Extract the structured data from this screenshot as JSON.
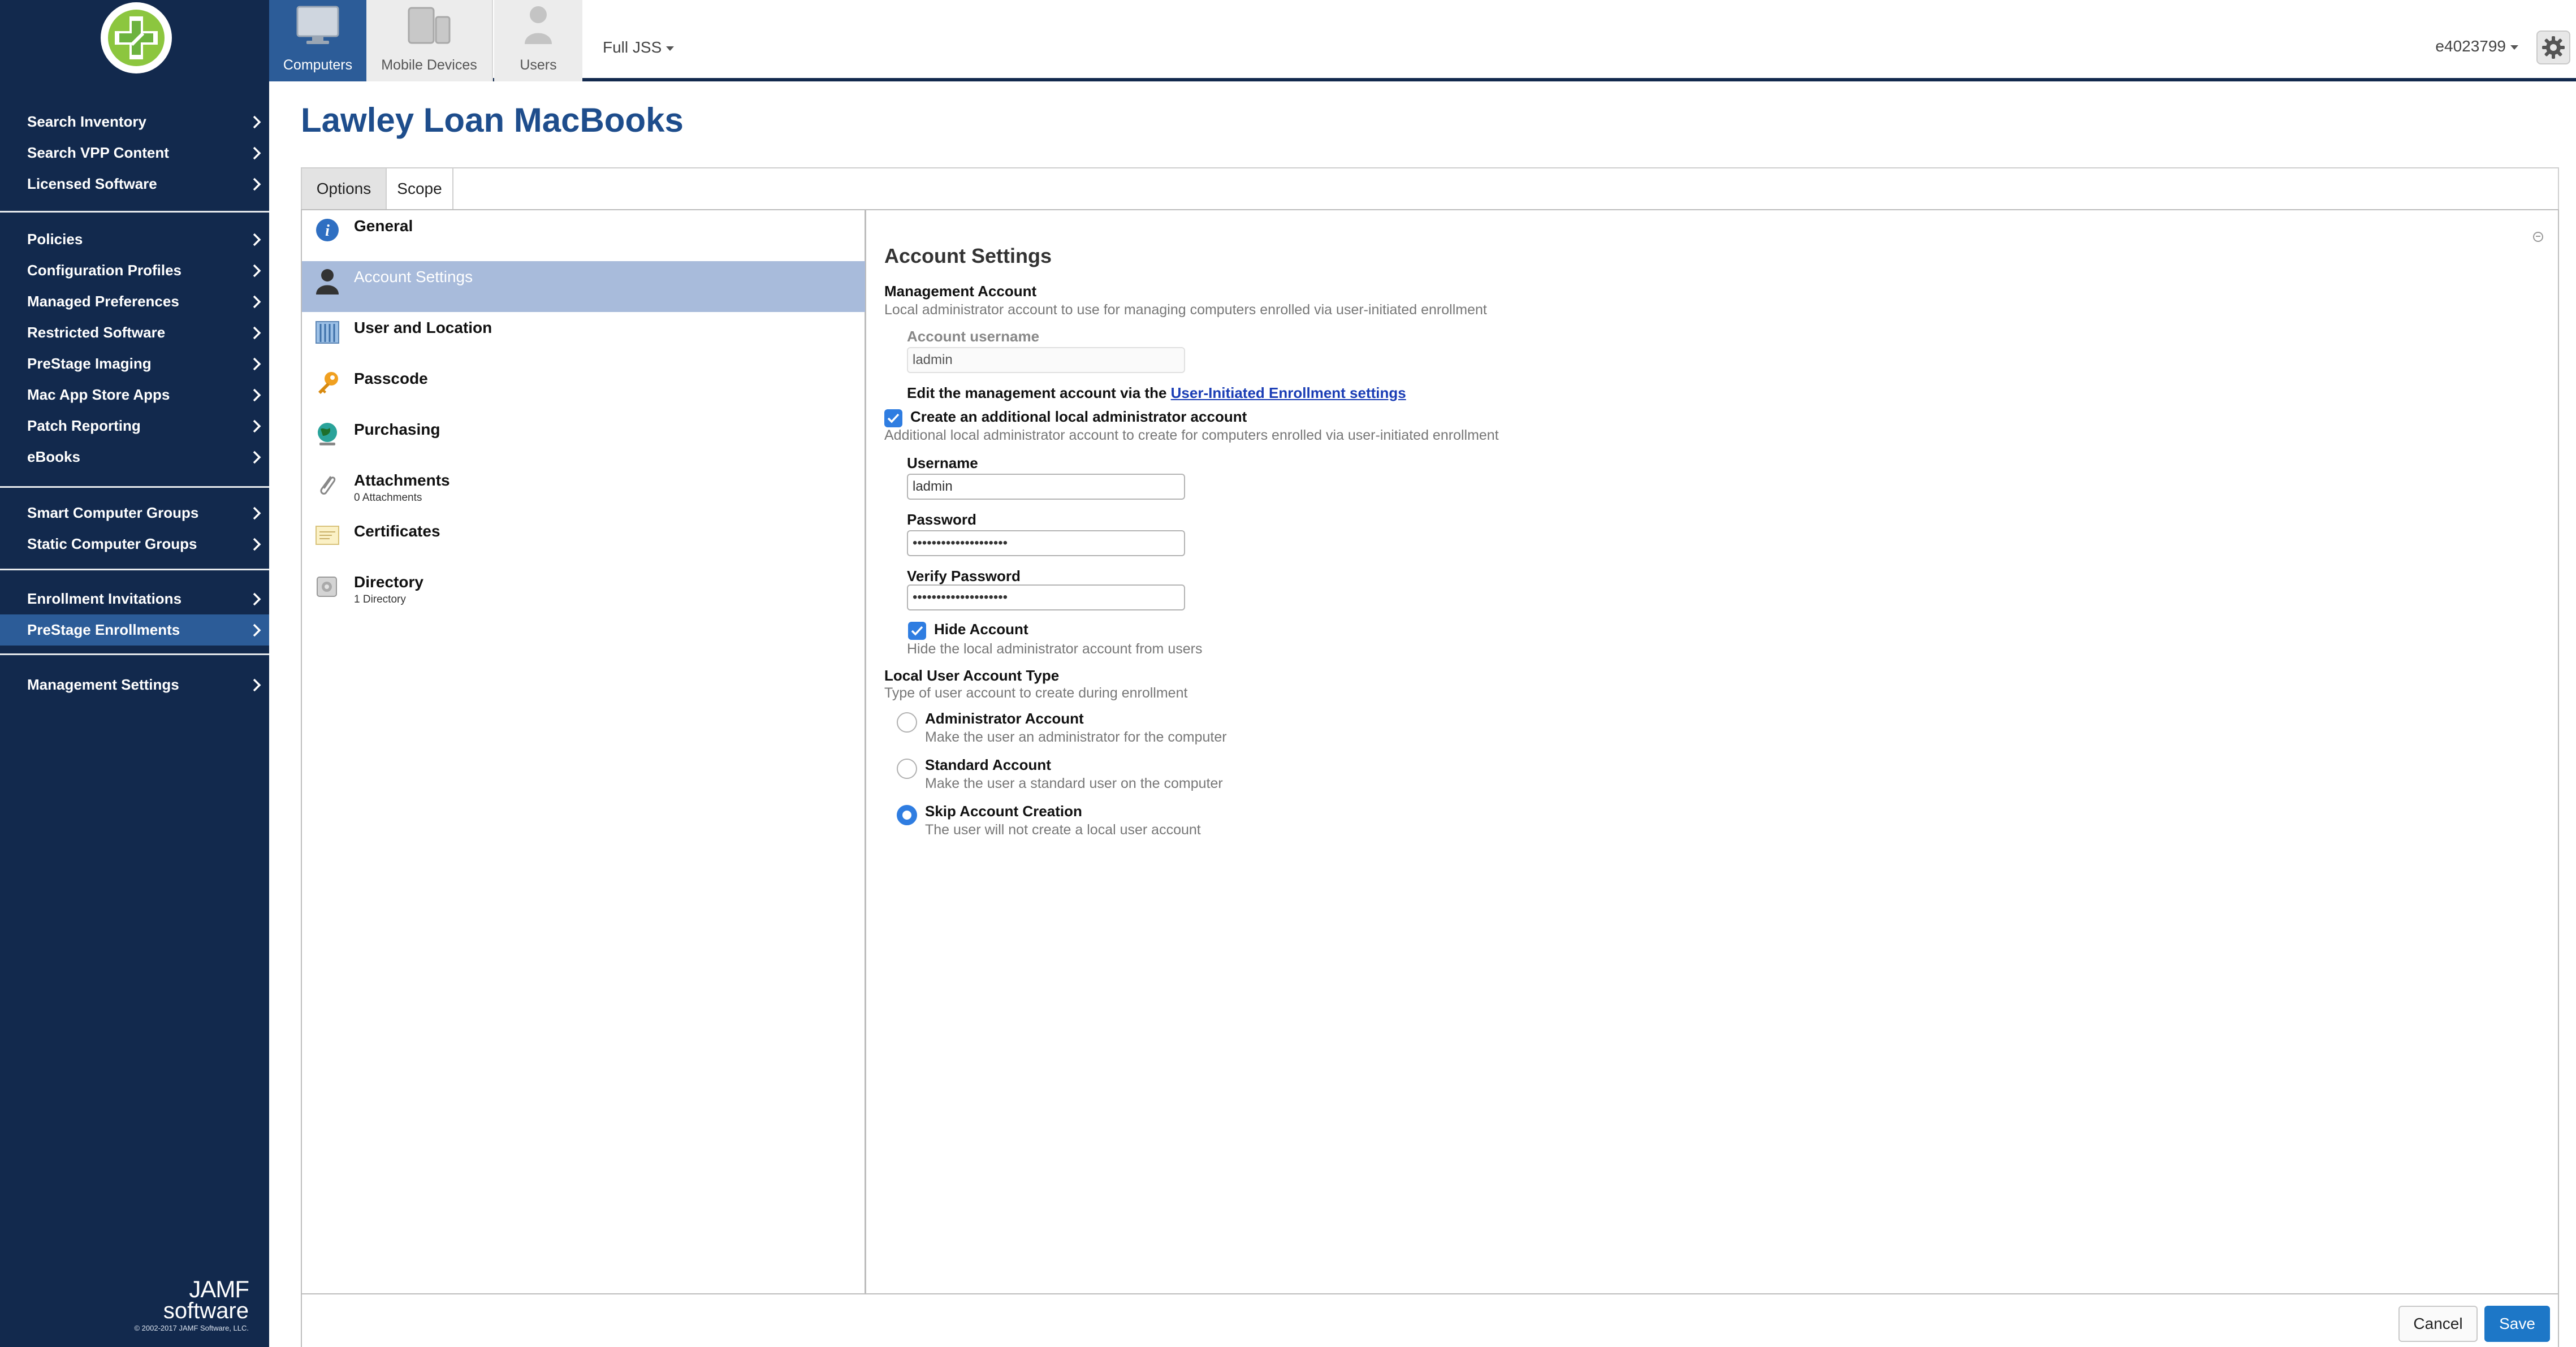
{
  "topbar": {
    "tabs": [
      {
        "label": "Computers",
        "icon": "monitor-icon"
      },
      {
        "label": "Mobile Devices",
        "icon": "devices-icon"
      },
      {
        "label": "Users",
        "icon": "user-icon"
      }
    ],
    "site": "Full JSS",
    "user": "e4023799",
    "settings_icon": "gear-icon"
  },
  "sidebar": {
    "groups": [
      [
        "Search Inventory",
        "Search VPP Content",
        "Licensed Software"
      ],
      [
        "Policies",
        "Configuration Profiles",
        "Managed Preferences",
        "Restricted Software",
        "PreStage Imaging",
        "Mac App Store Apps",
        "Patch Reporting",
        "eBooks"
      ],
      [
        "Smart Computer Groups",
        "Static Computer Groups"
      ],
      [
        "Enrollment Invitations",
        "PreStage Enrollments"
      ],
      [
        "Management Settings"
      ]
    ],
    "active": "PreStage Enrollments",
    "brand": {
      "name": "JAMF",
      "sub": "software",
      "copyright": "© 2002-2017 JAMF Software, LLC."
    }
  },
  "page": {
    "title": "Lawley Loan MacBooks"
  },
  "subtabs": [
    "Options",
    "Scope"
  ],
  "options_list": [
    {
      "label": "General",
      "sub": "",
      "icon": "info-icon"
    },
    {
      "label": "Account Settings",
      "sub": "",
      "icon": "person-icon"
    },
    {
      "label": "User and Location",
      "sub": "",
      "icon": "building-icon"
    },
    {
      "label": "Passcode",
      "sub": "",
      "icon": "key-icon"
    },
    {
      "label": "Purchasing",
      "sub": "",
      "icon": "globe-icon"
    },
    {
      "label": "Attachments",
      "sub": "0 Attachments",
      "icon": "paperclip-icon"
    },
    {
      "label": "Certificates",
      "sub": "",
      "icon": "certificate-icon"
    },
    {
      "label": "Directory",
      "sub": "1 Directory",
      "icon": "directory-icon"
    }
  ],
  "account": {
    "title": "Account Settings",
    "mgmt_label": "Management Account",
    "mgmt_desc": "Local administrator account to use for managing computers enrolled via user-initiated enrollment",
    "acct_username_label": "Account username",
    "acct_username_value": "ladmin",
    "edit_text": "Edit the management account via the ",
    "edit_link": "User-Initiated Enrollment settings",
    "create_label": "Create an additional local administrator account",
    "create_checked": true,
    "create_desc": "Additional local administrator account to create for computers enrolled via user-initiated enrollment",
    "username_label": "Username",
    "username_value": "ladmin",
    "password_label": "Password",
    "password_value": "••••••••••••••••••••",
    "verify_label": "Verify Password",
    "verify_value": "••••••••••••••••••••",
    "hide_label": "Hide Account",
    "hide_checked": true,
    "hide_desc": "Hide the local administrator account from users",
    "type_label": "Local User Account Type",
    "type_desc": "Type of user account to create during enrollment",
    "types": [
      {
        "label": "Administrator Account",
        "desc": "Make the user an administrator for the computer",
        "selected": false
      },
      {
        "label": "Standard Account",
        "desc": "Make the user a standard user on the computer",
        "selected": false
      },
      {
        "label": "Skip Account Creation",
        "desc": "The user will not create a local user account",
        "selected": true
      }
    ]
  },
  "footer": {
    "cancel": "Cancel",
    "save": "Save"
  },
  "colors": {
    "sidebar": "#12294d",
    "active": "#2c5c98",
    "accent": "#2f7de1",
    "save": "#1d77c7",
    "title": "#1e4d8c"
  }
}
